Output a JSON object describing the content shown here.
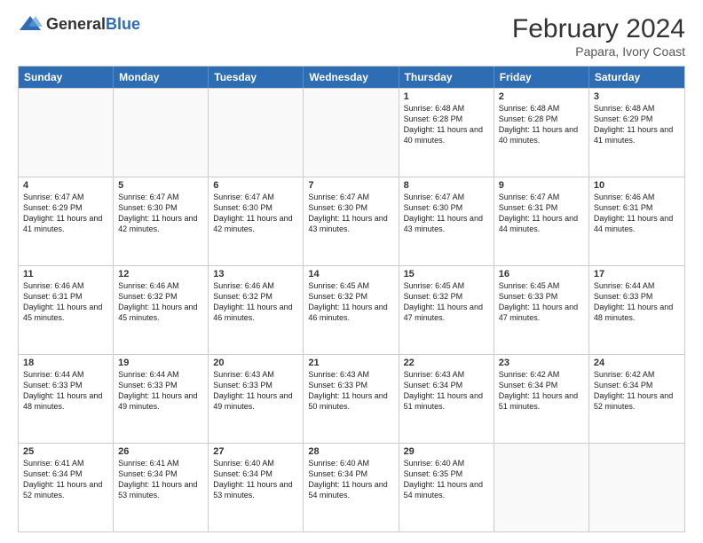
{
  "header": {
    "logo_general": "General",
    "logo_blue": "Blue",
    "month_title": "February 2024",
    "subtitle": "Papara, Ivory Coast"
  },
  "days_of_week": [
    "Sunday",
    "Monday",
    "Tuesday",
    "Wednesday",
    "Thursday",
    "Friday",
    "Saturday"
  ],
  "weeks": [
    [
      {
        "day": "",
        "info": ""
      },
      {
        "day": "",
        "info": ""
      },
      {
        "day": "",
        "info": ""
      },
      {
        "day": "",
        "info": ""
      },
      {
        "day": "1",
        "info": "Sunrise: 6:48 AM\nSunset: 6:28 PM\nDaylight: 11 hours and 40 minutes."
      },
      {
        "day": "2",
        "info": "Sunrise: 6:48 AM\nSunset: 6:28 PM\nDaylight: 11 hours and 40 minutes."
      },
      {
        "day": "3",
        "info": "Sunrise: 6:48 AM\nSunset: 6:29 PM\nDaylight: 11 hours and 41 minutes."
      }
    ],
    [
      {
        "day": "4",
        "info": "Sunrise: 6:47 AM\nSunset: 6:29 PM\nDaylight: 11 hours and 41 minutes."
      },
      {
        "day": "5",
        "info": "Sunrise: 6:47 AM\nSunset: 6:30 PM\nDaylight: 11 hours and 42 minutes."
      },
      {
        "day": "6",
        "info": "Sunrise: 6:47 AM\nSunset: 6:30 PM\nDaylight: 11 hours and 42 minutes."
      },
      {
        "day": "7",
        "info": "Sunrise: 6:47 AM\nSunset: 6:30 PM\nDaylight: 11 hours and 43 minutes."
      },
      {
        "day": "8",
        "info": "Sunrise: 6:47 AM\nSunset: 6:30 PM\nDaylight: 11 hours and 43 minutes."
      },
      {
        "day": "9",
        "info": "Sunrise: 6:47 AM\nSunset: 6:31 PM\nDaylight: 11 hours and 44 minutes."
      },
      {
        "day": "10",
        "info": "Sunrise: 6:46 AM\nSunset: 6:31 PM\nDaylight: 11 hours and 44 minutes."
      }
    ],
    [
      {
        "day": "11",
        "info": "Sunrise: 6:46 AM\nSunset: 6:31 PM\nDaylight: 11 hours and 45 minutes."
      },
      {
        "day": "12",
        "info": "Sunrise: 6:46 AM\nSunset: 6:32 PM\nDaylight: 11 hours and 45 minutes."
      },
      {
        "day": "13",
        "info": "Sunrise: 6:46 AM\nSunset: 6:32 PM\nDaylight: 11 hours and 46 minutes."
      },
      {
        "day": "14",
        "info": "Sunrise: 6:45 AM\nSunset: 6:32 PM\nDaylight: 11 hours and 46 minutes."
      },
      {
        "day": "15",
        "info": "Sunrise: 6:45 AM\nSunset: 6:32 PM\nDaylight: 11 hours and 47 minutes."
      },
      {
        "day": "16",
        "info": "Sunrise: 6:45 AM\nSunset: 6:33 PM\nDaylight: 11 hours and 47 minutes."
      },
      {
        "day": "17",
        "info": "Sunrise: 6:44 AM\nSunset: 6:33 PM\nDaylight: 11 hours and 48 minutes."
      }
    ],
    [
      {
        "day": "18",
        "info": "Sunrise: 6:44 AM\nSunset: 6:33 PM\nDaylight: 11 hours and 48 minutes."
      },
      {
        "day": "19",
        "info": "Sunrise: 6:44 AM\nSunset: 6:33 PM\nDaylight: 11 hours and 49 minutes."
      },
      {
        "day": "20",
        "info": "Sunrise: 6:43 AM\nSunset: 6:33 PM\nDaylight: 11 hours and 49 minutes."
      },
      {
        "day": "21",
        "info": "Sunrise: 6:43 AM\nSunset: 6:33 PM\nDaylight: 11 hours and 50 minutes."
      },
      {
        "day": "22",
        "info": "Sunrise: 6:43 AM\nSunset: 6:34 PM\nDaylight: 11 hours and 51 minutes."
      },
      {
        "day": "23",
        "info": "Sunrise: 6:42 AM\nSunset: 6:34 PM\nDaylight: 11 hours and 51 minutes."
      },
      {
        "day": "24",
        "info": "Sunrise: 6:42 AM\nSunset: 6:34 PM\nDaylight: 11 hours and 52 minutes."
      }
    ],
    [
      {
        "day": "25",
        "info": "Sunrise: 6:41 AM\nSunset: 6:34 PM\nDaylight: 11 hours and 52 minutes."
      },
      {
        "day": "26",
        "info": "Sunrise: 6:41 AM\nSunset: 6:34 PM\nDaylight: 11 hours and 53 minutes."
      },
      {
        "day": "27",
        "info": "Sunrise: 6:40 AM\nSunset: 6:34 PM\nDaylight: 11 hours and 53 minutes."
      },
      {
        "day": "28",
        "info": "Sunrise: 6:40 AM\nSunset: 6:34 PM\nDaylight: 11 hours and 54 minutes."
      },
      {
        "day": "29",
        "info": "Sunrise: 6:40 AM\nSunset: 6:35 PM\nDaylight: 11 hours and 54 minutes."
      },
      {
        "day": "",
        "info": ""
      },
      {
        "day": "",
        "info": ""
      }
    ]
  ]
}
